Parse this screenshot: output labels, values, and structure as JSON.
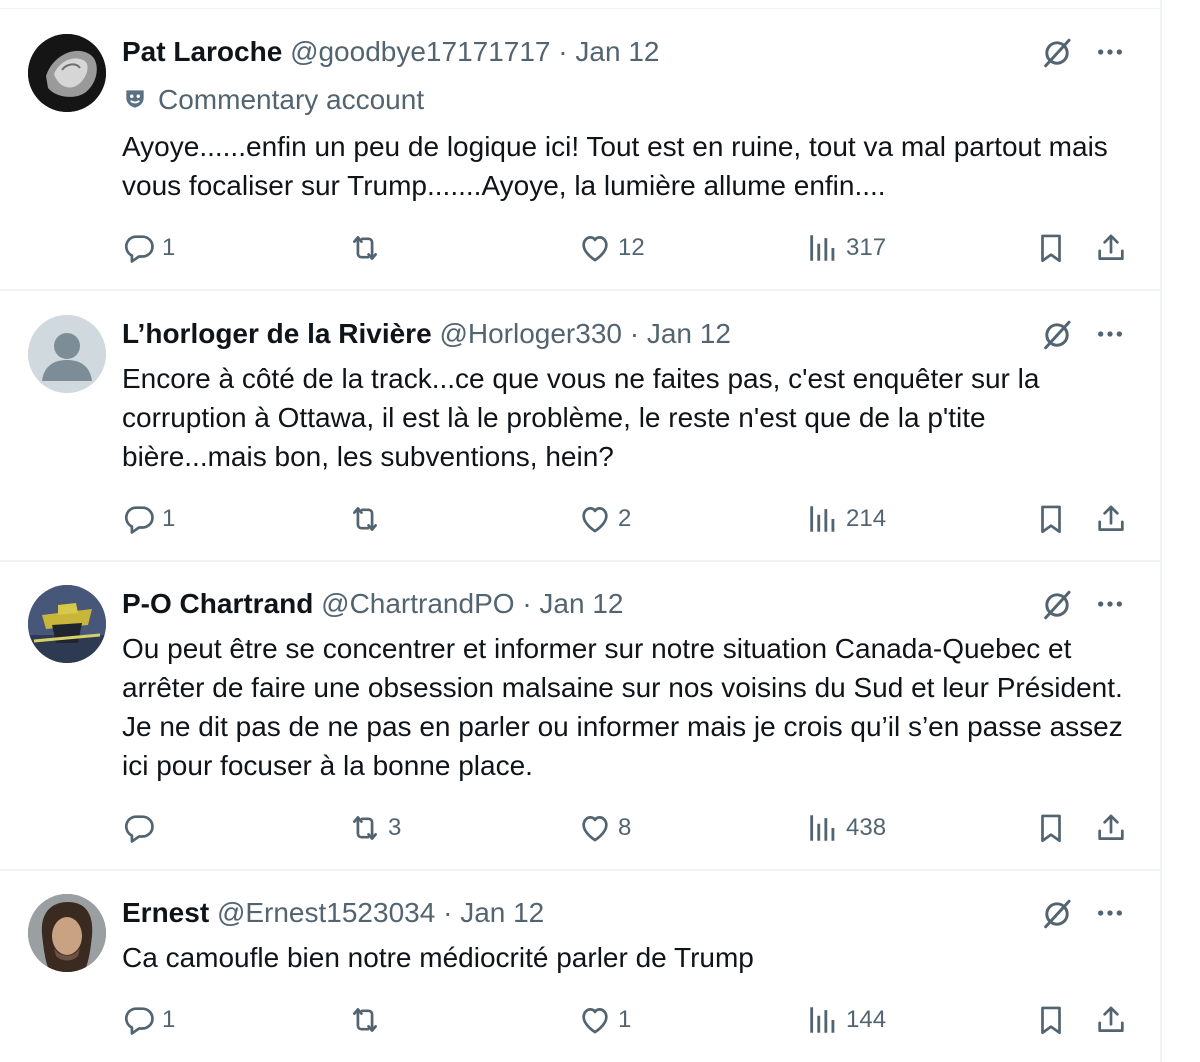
{
  "tweets": [
    {
      "name": "Pat Laroche",
      "handle": "@goodbye17171717",
      "sep": "·",
      "date": "Jan 12",
      "label": "Commentary account",
      "text": "Ayoye......enfin un peu de logique ici! Tout est en ruine, tout va mal partout mais vous focaliser sur Trump.......Ayoye, la lumière allume enfin....",
      "replies": "1",
      "reposts": "",
      "likes": "12",
      "views": "317"
    },
    {
      "name": "L’horloger de la Rivière",
      "handle": "@Horloger330",
      "sep": "·",
      "date": "Jan 12",
      "text": "Encore à côté de la track...ce que vous ne faites pas, c'est enquêter sur la corruption à Ottawa, il est là le problème, le reste n'est que de la p'tite bière...mais bon, les subventions, hein?",
      "replies": "1",
      "reposts": "",
      "likes": "2",
      "views": "214"
    },
    {
      "name": "P-O Chartrand",
      "handle": "@ChartrandPO",
      "sep": "·",
      "date": "Jan 12",
      "text": "Ou peut être se concentrer et informer sur notre situation Canada-Quebec et arrêter de faire une obsession malsaine sur nos voisins du Sud et leur Président. Je ne dit pas de ne pas en parler ou informer mais je crois qu’il s’en passe assez ici pour focuser à la bonne place.",
      "replies": "",
      "reposts": "3",
      "likes": "8",
      "views": "438"
    },
    {
      "name": "Ernest",
      "handle": "@Ernest1523034",
      "sep": "·",
      "date": "Jan 12",
      "text": "Ca camoufle bien notre médiocrité parler de Trump",
      "replies": "1",
      "reposts": "",
      "likes": "1",
      "views": "144"
    }
  ],
  "icons": {
    "reply": "reply-icon",
    "repost": "repost-icon",
    "like": "heart-icon",
    "views": "views-icon",
    "bookmark": "bookmark-icon",
    "share": "share-icon",
    "grok": "grok-icon",
    "more": "more-icon"
  },
  "colors": {
    "text": "#0f1419",
    "secondary": "#536471",
    "border": "#eff3f4",
    "badge": "#5b7083"
  }
}
